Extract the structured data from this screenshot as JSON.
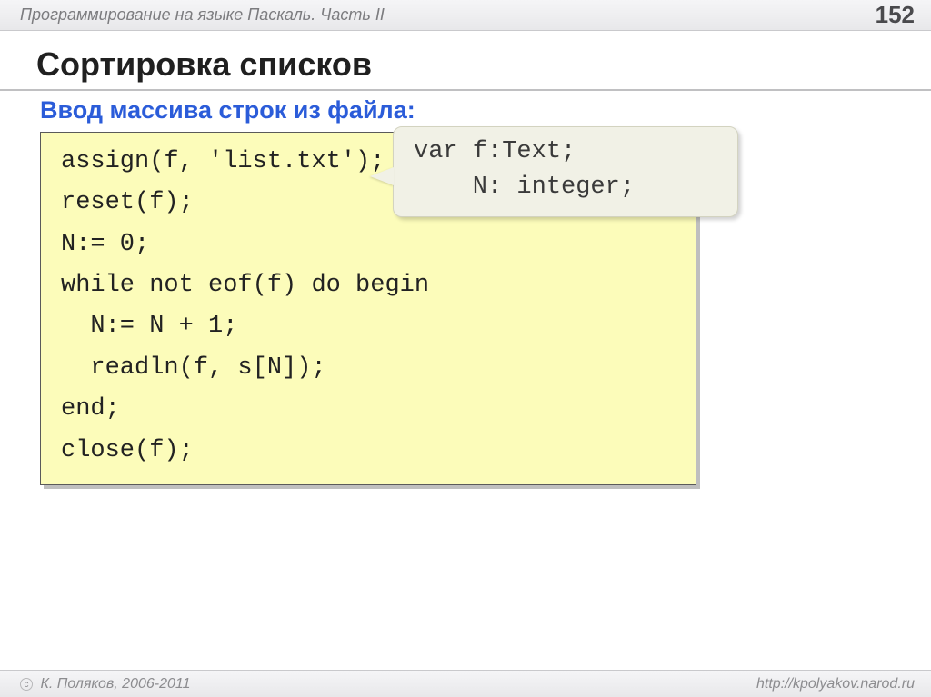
{
  "header": {
    "title": "Программирование на языке Паскаль. Часть II",
    "page_number": "152"
  },
  "main": {
    "title": "Сортировка списков",
    "subtitle": "Ввод массива строк из файла:"
  },
  "code": {
    "lines": [
      "assign(f, 'list.txt');",
      "reset(f);",
      "N:= 0;",
      "while not eof(f) do begin",
      "  N:= N + 1;",
      "  readln(f, s[N]);",
      "end;",
      "close(f);"
    ]
  },
  "callout": {
    "lines": [
      "var f:Text;",
      "    N: integer;"
    ]
  },
  "footer": {
    "copyright": "К. Поляков, 2006-2011",
    "url": "http://kpolyakov.narod.ru"
  }
}
